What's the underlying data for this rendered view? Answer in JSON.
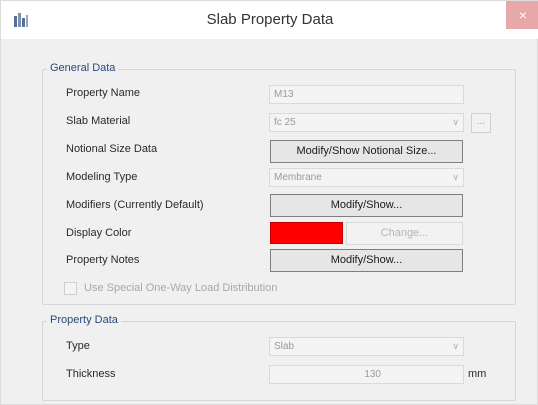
{
  "window": {
    "title": "Slab Property Data",
    "close_glyph": "×",
    "app_icon": "app-icon"
  },
  "general": {
    "group_title": "General Data",
    "property_name_label": "Property Name",
    "property_name_value": "M13",
    "slab_material_label": "Slab Material",
    "slab_material_value": "fc 25",
    "ellipsis_label": "...",
    "notional_size_label": "Notional Size Data",
    "notional_size_button": "Modify/Show Notional Size...",
    "modeling_type_label": "Modeling Type",
    "modeling_type_value": "Membrane",
    "modifiers_label": "Modifiers (Currently Default)",
    "modifiers_button": "Modify/Show...",
    "display_color_label": "Display Color",
    "display_color": "#ff0000",
    "change_button": "Change...",
    "property_notes_label": "Property Notes",
    "property_notes_button": "Modify/Show...",
    "one_way_label": "Use Special One-Way Load Distribution"
  },
  "property": {
    "group_title": "Property Data",
    "type_label": "Type",
    "type_value": "Slab",
    "thickness_label": "Thickness",
    "thickness_value": "130",
    "thickness_unit": "mm"
  }
}
